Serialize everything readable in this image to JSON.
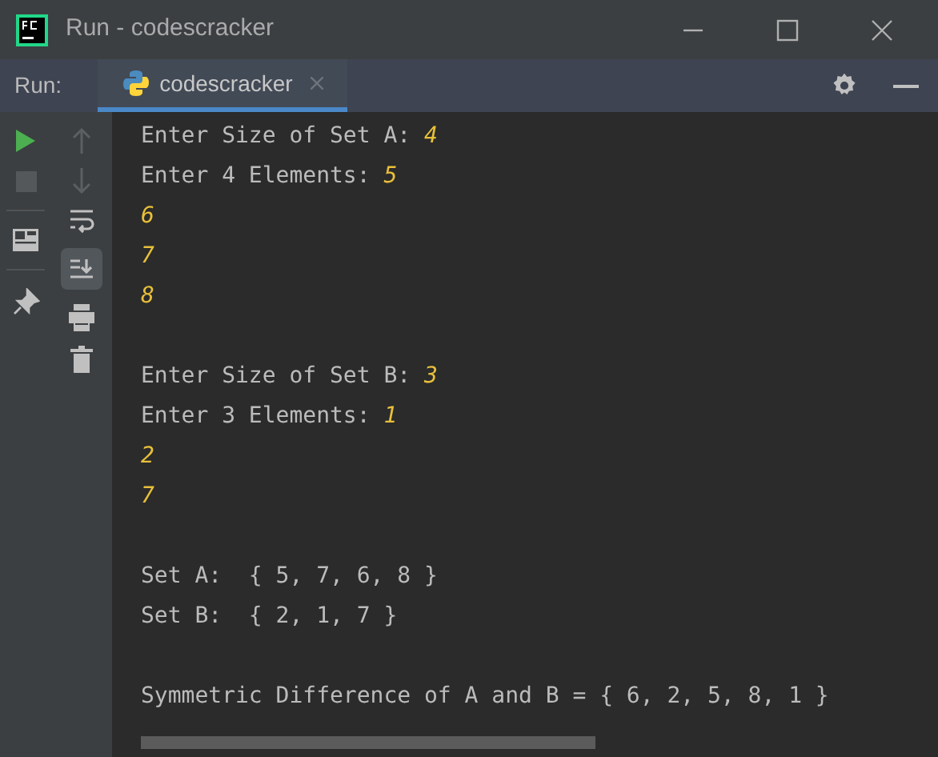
{
  "window": {
    "title": "Run - codescracker"
  },
  "run_bar": {
    "label": "Run:",
    "tabs": [
      {
        "label": "codescracker",
        "selected": true
      }
    ]
  },
  "console": {
    "lines": [
      {
        "kind": "text",
        "parts": [
          {
            "kind": "output",
            "text": "Enter Size of Set A: "
          },
          {
            "kind": "input",
            "text": "4"
          }
        ]
      },
      {
        "kind": "text",
        "parts": [
          {
            "kind": "output",
            "text": "Enter 4 Elements: "
          },
          {
            "kind": "input",
            "text": "5"
          }
        ]
      },
      {
        "kind": "text",
        "parts": [
          {
            "kind": "input",
            "text": "6"
          }
        ]
      },
      {
        "kind": "text",
        "parts": [
          {
            "kind": "input",
            "text": "7"
          }
        ]
      },
      {
        "kind": "text",
        "parts": [
          {
            "kind": "input",
            "text": "8"
          }
        ]
      },
      {
        "kind": "blank"
      },
      {
        "kind": "text",
        "parts": [
          {
            "kind": "output",
            "text": "Enter Size of Set B: "
          },
          {
            "kind": "input",
            "text": "3"
          }
        ]
      },
      {
        "kind": "text",
        "parts": [
          {
            "kind": "output",
            "text": "Enter 3 Elements: "
          },
          {
            "kind": "input",
            "text": "1"
          }
        ]
      },
      {
        "kind": "text",
        "parts": [
          {
            "kind": "input",
            "text": "2"
          }
        ]
      },
      {
        "kind": "text",
        "parts": [
          {
            "kind": "input",
            "text": "7"
          }
        ]
      },
      {
        "kind": "blank"
      },
      {
        "kind": "text",
        "parts": [
          {
            "kind": "output",
            "text": "Set A:  { 5, 7, 6, 8 }"
          }
        ]
      },
      {
        "kind": "text",
        "parts": [
          {
            "kind": "output",
            "text": "Set B:  { 2, 1, 7 }"
          }
        ]
      },
      {
        "kind": "blank"
      },
      {
        "kind": "text",
        "parts": [
          {
            "kind": "output",
            "text": "Symmetric Difference of A and B = { 6, 2, 5, 8, 1 }"
          }
        ]
      }
    ]
  }
}
